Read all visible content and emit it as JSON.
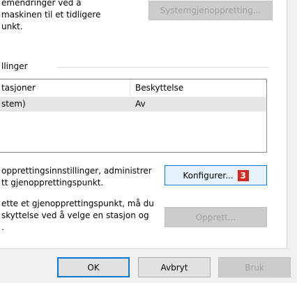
{
  "top_section": {
    "desc_lines": [
      "emendringer ved å",
      "maskinen til et tidligere",
      "unkt."
    ],
    "system_restore_button": "Systemgjenoppretting..."
  },
  "protection_group": {
    "title": "llinger",
    "table": {
      "headers": [
        "tasjoner",
        "Beskyttelse"
      ],
      "rows": [
        {
          "drive": "stem)",
          "protection": "Av"
        }
      ]
    }
  },
  "configure_section": {
    "desc_lines": [
      "opprettingsinnstillinger, administrer",
      "tt gjenopprettingspunkt."
    ],
    "configure_button": "Konfigurer...",
    "step_badge": "3"
  },
  "create_section": {
    "desc_lines": [
      "ette et gjenopprettingspunkt, må du",
      "skyttelse ved å velge en stasjon og",
      "."
    ],
    "create_button": "Opprett..."
  },
  "footer": {
    "ok": "OK",
    "cancel": "Avbryt",
    "apply": "Bruk"
  },
  "colors": {
    "accent": "#0078d7",
    "badge": "#d52b1e"
  }
}
